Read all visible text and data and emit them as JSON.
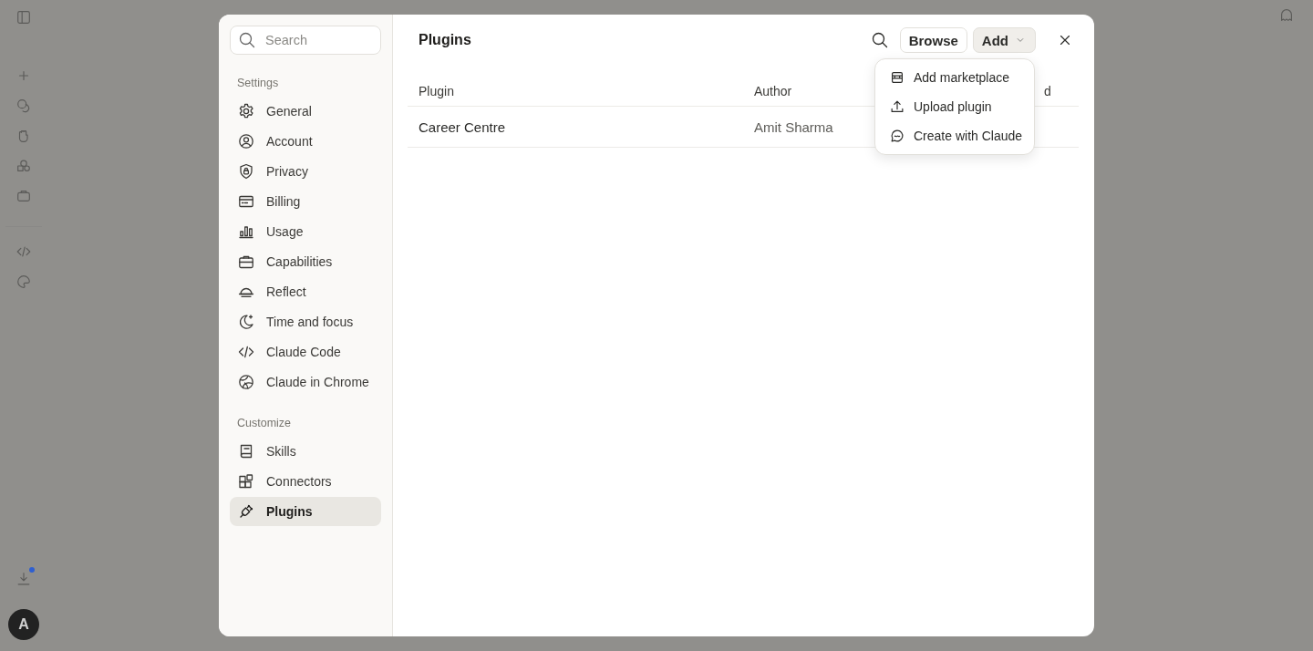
{
  "rail": {
    "avatar": "A",
    "notification": true
  },
  "sidebar": {
    "search": {
      "placeholder": "Search"
    },
    "sections": [
      {
        "heading": "Settings",
        "items": [
          {
            "label": "General",
            "selected": false
          },
          {
            "label": "Account",
            "selected": false
          },
          {
            "label": "Privacy",
            "selected": false
          },
          {
            "label": "Billing",
            "selected": false
          },
          {
            "label": "Usage",
            "selected": false
          },
          {
            "label": "Capabilities",
            "selected": false
          },
          {
            "label": "Reflect",
            "selected": false
          },
          {
            "label": "Time and focus",
            "selected": false
          },
          {
            "label": "Claude Code",
            "selected": false
          },
          {
            "label": "Claude in Chrome",
            "selected": false
          }
        ]
      },
      {
        "heading": "Customize",
        "items": [
          {
            "label": "Skills",
            "selected": false
          },
          {
            "label": "Connectors",
            "selected": false
          },
          {
            "label": "Plugins",
            "selected": true
          }
        ]
      }
    ]
  },
  "main": {
    "title": "Plugins",
    "browse": "Browse",
    "add": "Add",
    "table": {
      "columns": [
        "Plugin",
        "Author",
        "d"
      ],
      "rows": [
        [
          "Career Centre",
          "Amit Sharma"
        ]
      ]
    },
    "menu": {
      "items": [
        "Add marketplace",
        "Upload plugin",
        "Create with Claude"
      ]
    }
  }
}
